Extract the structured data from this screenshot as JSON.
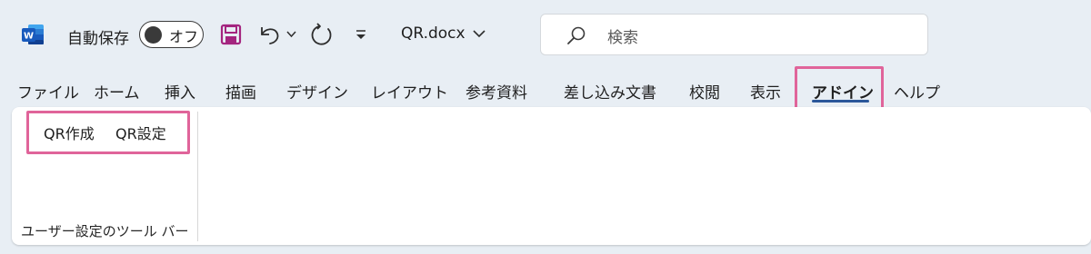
{
  "titlebar": {
    "app_icon": "word-icon",
    "app_icon_letter": "W",
    "autosave_label": "自動保存",
    "autosave_toggle": "オフ",
    "save_icon": "save-icon",
    "undo_icon": "undo-icon",
    "redo_icon": "redo-icon",
    "customize_qat_icon": "chevron-down-icon",
    "filename": "QR.docx",
    "search_placeholder": "検索",
    "brand_color": "#2b579a"
  },
  "tabs": [
    {
      "label": "ファイル"
    },
    {
      "label": "ホーム"
    },
    {
      "label": "挿入"
    },
    {
      "label": "描画"
    },
    {
      "label": "デザイン"
    },
    {
      "label": "レイアウト"
    },
    {
      "label": "参考資料"
    },
    {
      "label": "差し込み文書"
    },
    {
      "label": "校閲"
    },
    {
      "label": "表示"
    },
    {
      "label": "アドイン",
      "active": true
    },
    {
      "label": "ヘルプ"
    }
  ],
  "ribbon": {
    "buttons": [
      "QR作成",
      "QR設定"
    ],
    "group_label": "ユーザー設定のツール バー"
  },
  "highlight_color": "#e0649a"
}
